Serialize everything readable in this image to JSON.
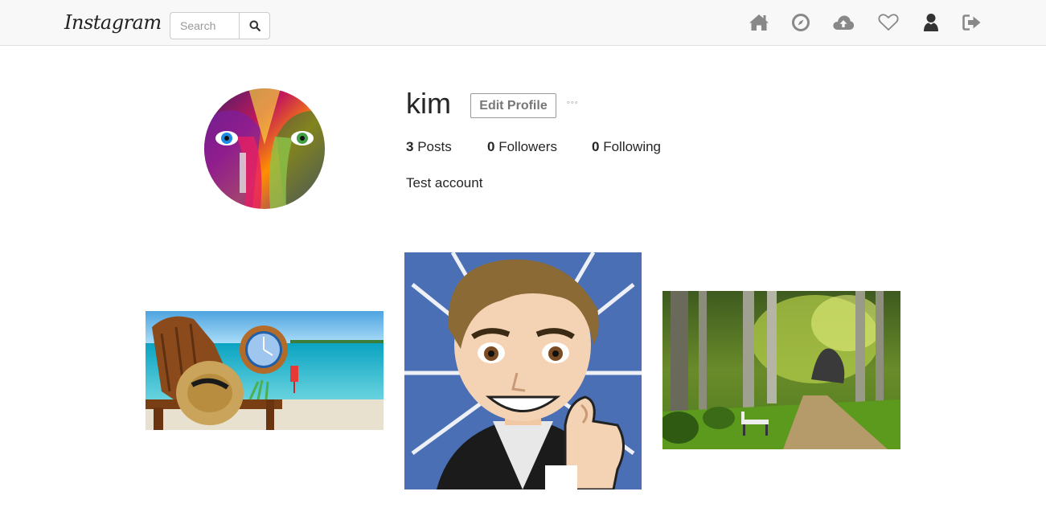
{
  "navbar": {
    "brand": "Instagram",
    "search": {
      "placeholder": "Search",
      "value": ""
    },
    "icons": [
      "home-icon",
      "explore-compass-icon",
      "upload-cloud-icon",
      "heart-icon",
      "user-icon",
      "logout-icon"
    ]
  },
  "profile": {
    "username": "kim",
    "edit_label": "Edit Profile",
    "more_label": "◦◦◦",
    "stats": {
      "posts_count": "3",
      "posts_label": "Posts",
      "followers_count": "0",
      "followers_label": "Followers",
      "following_count": "0",
      "following_label": "Following"
    },
    "bio": "Test account"
  },
  "posts": [
    {
      "subject": "beach chair with hat and clock by the sea"
    },
    {
      "subject": "cartoon avatar giving thumbs up"
    },
    {
      "subject": "park path with bench among trees"
    }
  ]
}
